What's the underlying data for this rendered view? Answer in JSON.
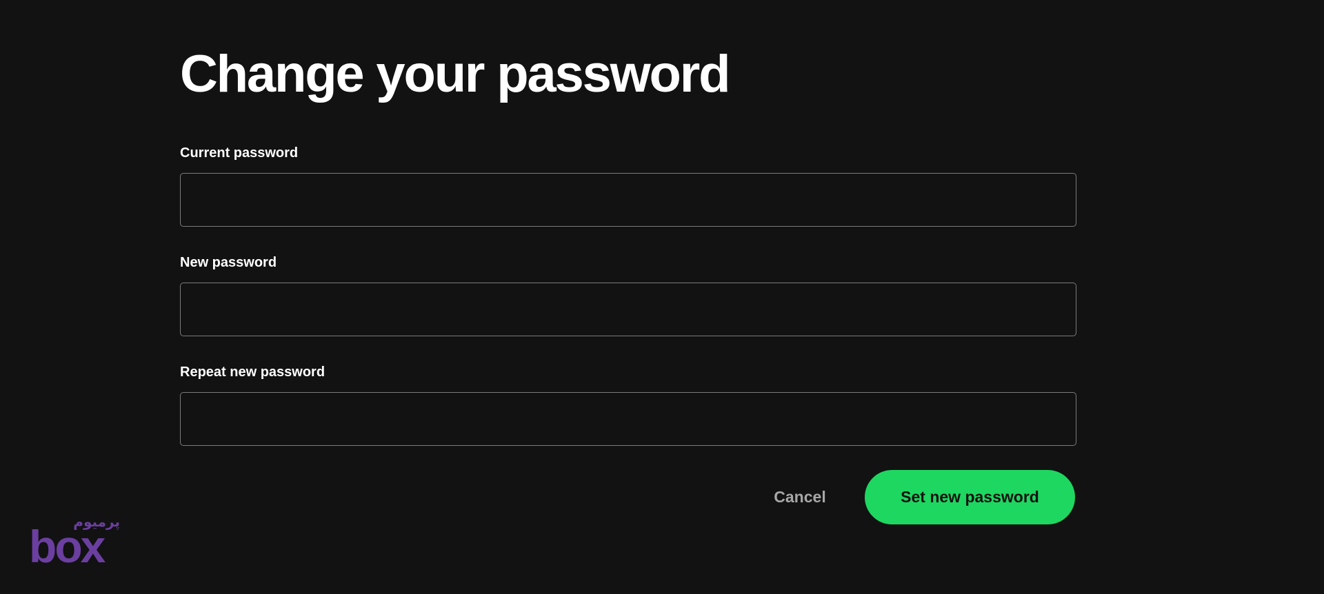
{
  "page": {
    "title": "Change your password"
  },
  "form": {
    "current_password": {
      "label": "Current password",
      "value": ""
    },
    "new_password": {
      "label": "New password",
      "value": ""
    },
    "repeat_password": {
      "label": "Repeat new password",
      "value": ""
    }
  },
  "actions": {
    "cancel_label": "Cancel",
    "submit_label": "Set new password"
  },
  "watermark": {
    "text_top": "پرمیوم",
    "text_main": "box"
  },
  "colors": {
    "background": "#121212",
    "accent": "#1ed760",
    "input_border": "#7c7c7c",
    "muted_text": "#a7a7a7",
    "watermark": "#6b3fa0"
  }
}
